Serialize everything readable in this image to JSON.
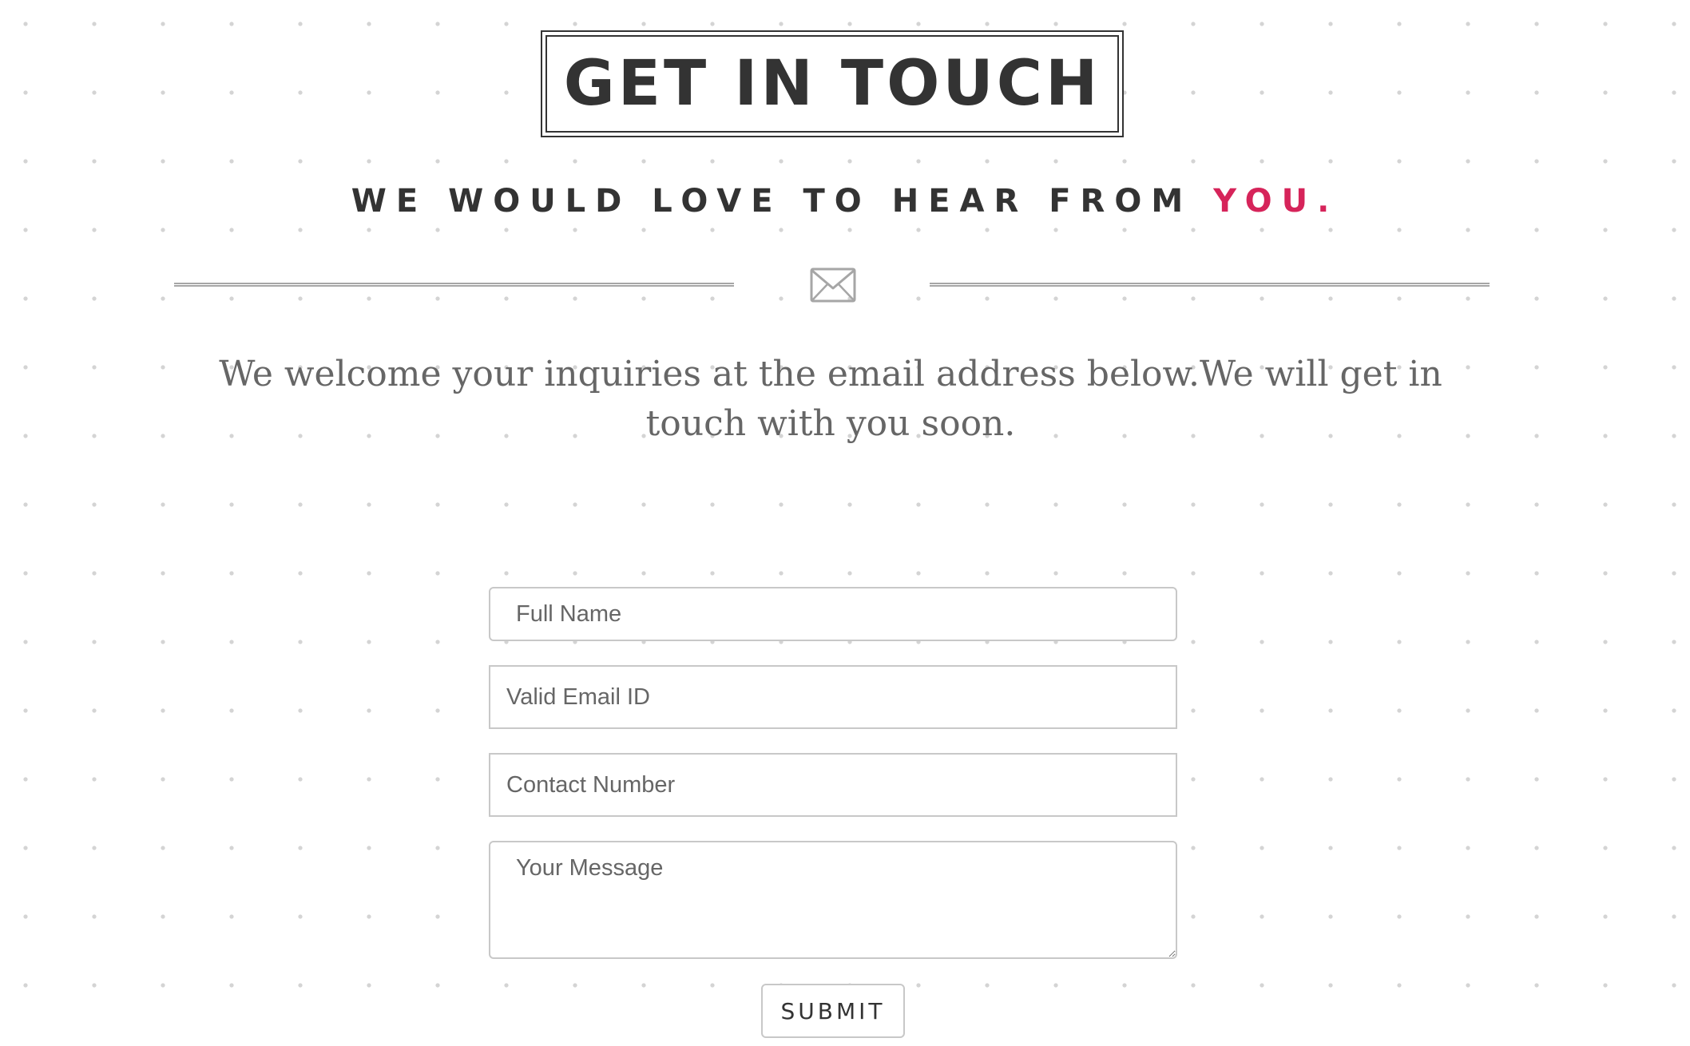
{
  "header": {
    "title": "GET IN TOUCH",
    "subtitle_main": "WE WOULD LOVE TO HEAR FROM ",
    "subtitle_accent": "YOU."
  },
  "divider": {
    "icon": "envelope-icon"
  },
  "intro": {
    "text": "We welcome your inquiries at the email address below.We will get in touch with you soon."
  },
  "form": {
    "name_placeholder": "Full Name",
    "email_placeholder": "Valid Email ID",
    "phone_placeholder": "Contact Number",
    "message_placeholder": "Your Message",
    "submit_label": "SUBMIT"
  },
  "colors": {
    "accent": "#d6245a",
    "heading": "#333333",
    "body_text": "#666666",
    "border": "#c8c8c8",
    "background_dots": "#d4d4d4"
  }
}
